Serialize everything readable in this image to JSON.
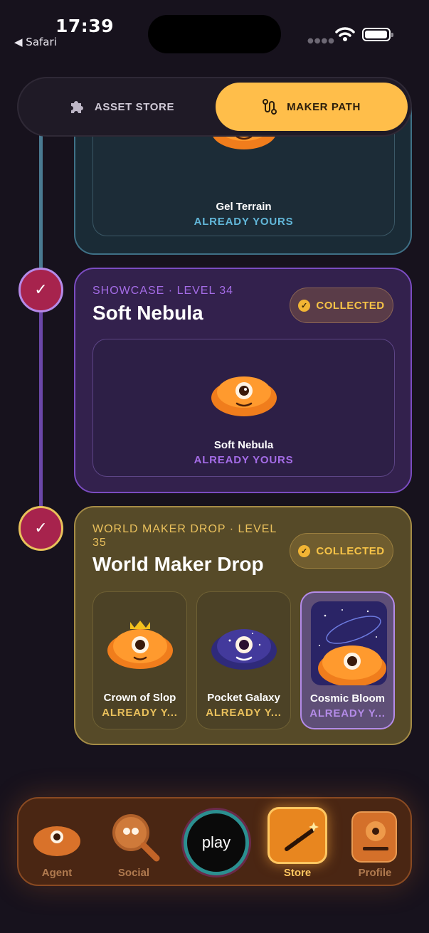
{
  "status_bar": {
    "time": "17:39",
    "back_label": "◀ Safari"
  },
  "segment": {
    "asset_store": "ASSET STORE",
    "maker_path": "MAKER PATH"
  },
  "cards": {
    "top": {
      "item_name": "Gel Terrain",
      "owned_label": "ALREADY YOURS"
    },
    "nebula": {
      "kicker": "SHOWCASE · LEVEL 34",
      "title": "Soft Nebula",
      "badge": "COLLECTED",
      "item_name": "Soft Nebula",
      "owned_label": "ALREADY YOURS"
    },
    "drop": {
      "kicker_line1": "WORLD MAKER DROP · LEVEL",
      "kicker_line2": "35",
      "title": "World Maker Drop",
      "badge": "COLLECTED",
      "items": [
        {
          "name": "Crown of Slop",
          "owned": "ALREADY Y..."
        },
        {
          "name": "Pocket Galaxy",
          "owned": "ALREADY Y..."
        },
        {
          "name": "Cosmic Bloom",
          "owned": "ALREADY Y..."
        }
      ]
    }
  },
  "nav": {
    "agent": "Agent",
    "social": "Social",
    "play": "play",
    "store": "Store",
    "profile": "Profile"
  },
  "colors": {
    "accent": "#ffbe4a",
    "nebula_accent": "#a46ce6",
    "gold": "#f6c347",
    "teal": "#62b7d9"
  }
}
